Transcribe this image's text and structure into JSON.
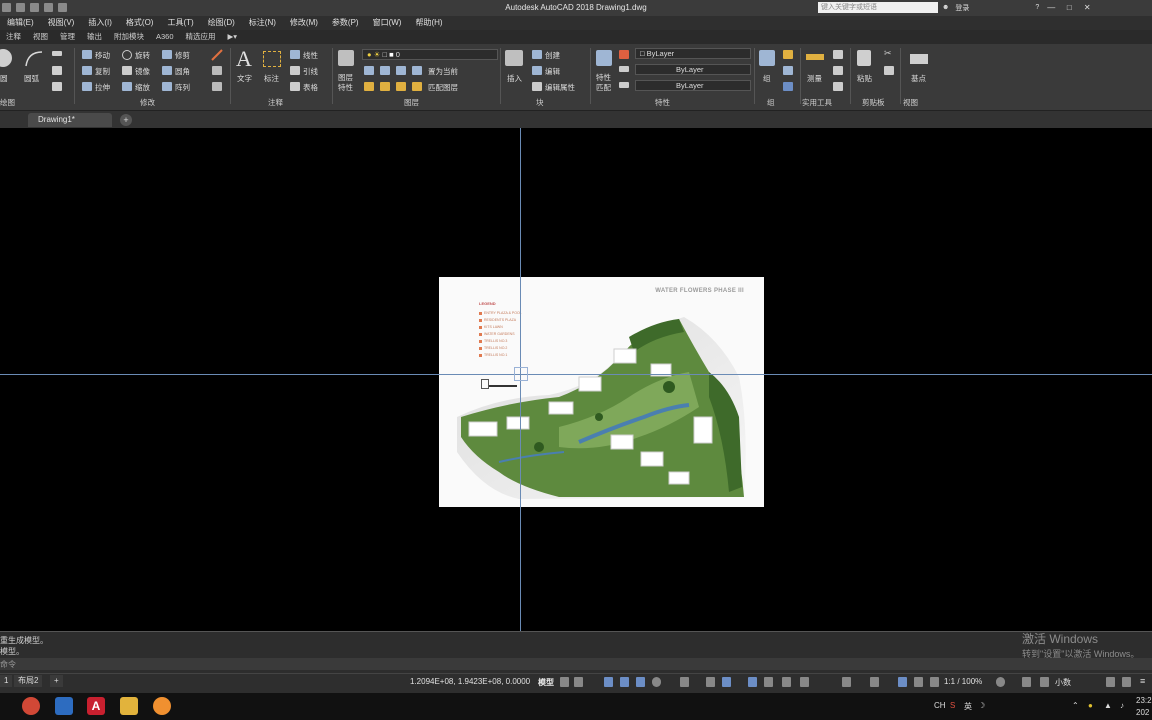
{
  "title": "Autodesk AutoCAD 2018    Drawing1.dwg",
  "search": {
    "placeholder": "键入关键字或短语"
  },
  "user": {
    "login": "登录"
  },
  "menu": [
    "编辑(E)",
    "视图(V)",
    "插入(I)",
    "格式(O)",
    "工具(T)",
    "绘图(D)",
    "标注(N)",
    "修改(M)",
    "参数(P)",
    "窗口(W)",
    "帮助(H)"
  ],
  "ribbon_tabs": [
    "注释",
    "视图",
    "管理",
    "输出",
    "附加模块",
    "A360",
    "精选应用"
  ],
  "ribbon": {
    "draw": {
      "circle": "圆",
      "arc": "圆弧"
    },
    "modify": {
      "move": "移动",
      "rotate": "旋转",
      "trim": "修剪",
      "copy": "复制",
      "mirror": "镜像",
      "fillet": "圆角",
      "stretch": "拉伸",
      "scale": "缩放",
      "array": "阵列"
    },
    "annotation": {
      "text": "文字",
      "dimension": "标注",
      "linear": "线性",
      "leader": "引线",
      "table": "表格"
    },
    "layers": {
      "layer_props": "图层\n特性",
      "layer_value": "0",
      "set_current": "置为当前",
      "match_layer": "匹配图层"
    },
    "block": {
      "insert": "插入",
      "create": "创建",
      "edit": "编辑",
      "edit_attr": "编辑属性"
    },
    "properties": {
      "match": "特性\n匹配",
      "color": "ByLayer",
      "linetype": "ByLayer",
      "lineweight": "ByLayer"
    },
    "group": {
      "label": "组"
    },
    "utilities": {
      "measure": "测量"
    },
    "clipboard": {
      "paste": "粘贴"
    },
    "view": {
      "base": "基点"
    },
    "panel_labels": [
      "绘图",
      "修改",
      "注释",
      "图层",
      "块",
      "特性",
      "组",
      "实用工具",
      "剪贴板",
      "视图"
    ]
  },
  "doc_tab": "Drawing1*",
  "image": {
    "title": "WATER FLOWERS PHASE III",
    "legend_title": "LEGEND",
    "legend_items": [
      "ENTRY PLAZA & POOL",
      "RESIDENTS PLAZA",
      "KITS LAWN",
      "WATER GARDENS",
      "TRELLIS NO.3",
      "TRELLIS NO.2",
      "TRELLIS NO.1"
    ]
  },
  "command": {
    "line1": "重生成模型。",
    "line2": "模型。",
    "prompt": "命令"
  },
  "watermark": {
    "line1": "激活 Windows",
    "line2": "转到\"设置\"以激活 Windows。"
  },
  "status": {
    "layout_tab_1": "1",
    "layout_tab_2": "布局2",
    "coords": "1.2094E+08, 1.9423E+08, 0.0000",
    "model": "模型",
    "scale": "1:1 / 100%",
    "units": "小数"
  },
  "tray": {
    "ime": "英",
    "time": "23:2",
    "date": "202"
  }
}
